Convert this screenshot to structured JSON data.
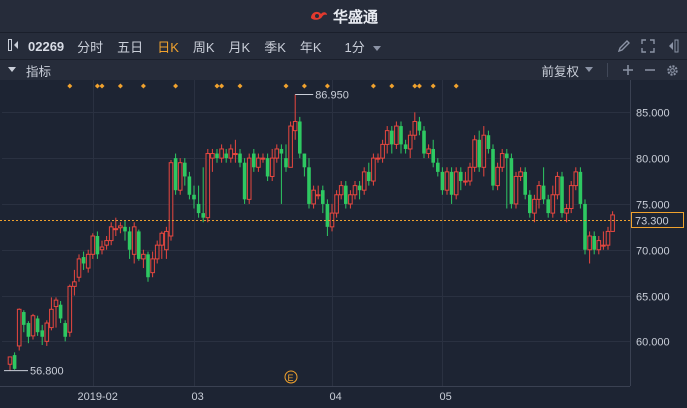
{
  "app": {
    "name": "华盛通"
  },
  "toolbar": {
    "stock_code": "02269",
    "periods": [
      {
        "label": "分时",
        "active": false
      },
      {
        "label": "五日",
        "active": false
      },
      {
        "label": "日K",
        "active": true
      },
      {
        "label": "周K",
        "active": false
      },
      {
        "label": "月K",
        "active": false
      },
      {
        "label": "季K",
        "active": false
      },
      {
        "label": "年K",
        "active": false
      },
      {
        "label": "1分",
        "active": false
      }
    ]
  },
  "indicator_bar": {
    "label": "指标",
    "adjust": "前复权"
  },
  "colors": {
    "up": "#e8473f",
    "down": "#2ec862",
    "accent": "#f0a22e"
  },
  "chart_data": {
    "type": "candlestick",
    "ylim": [
      56,
      87
    ],
    "y_ticks": [
      "85.000",
      "80.000",
      "75.000",
      "70.000",
      "65.000",
      "60.000"
    ],
    "x_tick_labels": [
      "2019-02",
      "03",
      "04",
      "05"
    ],
    "current_price": "73.300",
    "max_label": "86.950",
    "min_label": "56.800",
    "event_marker": "E",
    "candles": [
      [
        57.5,
        58.3,
        56.8,
        58.3
      ],
      [
        58.5,
        57.0,
        56.9,
        58.8
      ],
      [
        59.5,
        63.5,
        59.0,
        63.6
      ],
      [
        63.2,
        61.8,
        61.0,
        63.4
      ],
      [
        62.0,
        60.5,
        59.8,
        62.2
      ],
      [
        60.6,
        62.8,
        60.2,
        63.0
      ],
      [
        62.5,
        61.0,
        60.6,
        62.8
      ],
      [
        61.2,
        60.5,
        59.6,
        61.8
      ],
      [
        60.0,
        62.0,
        59.5,
        62.3
      ],
      [
        61.5,
        63.5,
        61.2,
        64.8
      ],
      [
        63.8,
        64.5,
        61.5,
        64.8
      ],
      [
        64.0,
        62.5,
        62.0,
        64.4
      ],
      [
        62.0,
        60.5,
        60.0,
        62.3
      ],
      [
        61.0,
        66.0,
        60.5,
        66.2
      ],
      [
        66.0,
        66.5,
        65.0,
        67.8
      ],
      [
        67.0,
        69.0,
        66.5,
        69.5
      ],
      [
        69.2,
        68.5,
        67.8,
        69.8
      ],
      [
        68.0,
        69.5,
        67.5,
        70.0
      ],
      [
        69.5,
        71.5,
        69.0,
        71.8
      ],
      [
        71.5,
        69.5,
        69.0,
        72.0
      ],
      [
        70.0,
        70.3,
        69.5,
        71.0
      ],
      [
        70.5,
        71.0,
        70.0,
        71.5
      ],
      [
        71.0,
        72.5,
        70.5,
        73.0
      ],
      [
        72.3,
        72.3,
        71.5,
        73.5
      ],
      [
        72.4,
        72.6,
        71.8,
        73.0
      ],
      [
        72.5,
        72.0,
        71.0,
        73.2
      ],
      [
        72.0,
        70.0,
        69.0,
        72.5
      ],
      [
        69.5,
        72.5,
        68.5,
        73.0
      ],
      [
        72.0,
        69.0,
        68.8,
        72.2
      ],
      [
        69.0,
        69.5,
        68.0,
        70.0
      ],
      [
        69.5,
        67.0,
        66.5,
        69.8
      ],
      [
        67.5,
        69.0,
        67.0,
        69.8
      ],
      [
        69.0,
        70.5,
        68.5,
        71.0
      ],
      [
        70.5,
        71.8,
        69.0,
        72.0
      ],
      [
        70.0,
        72.0,
        69.0,
        72.5
      ],
      [
        71.5,
        79.5,
        71.0,
        79.8
      ],
      [
        80.0,
        76.5,
        76.0,
        80.5
      ],
      [
        76.5,
        79.5,
        76.0,
        80.0
      ],
      [
        79.5,
        78.0,
        77.0,
        80.0
      ],
      [
        78.0,
        76.0,
        75.5,
        78.5
      ],
      [
        76.0,
        75.5,
        74.5,
        77.0
      ],
      [
        75.0,
        74.0,
        73.5,
        77.0
      ],
      [
        74.0,
        73.5,
        73.0,
        79.0
      ],
      [
        73.5,
        80.5,
        73.0,
        81.0
      ],
      [
        80.0,
        80.5,
        78.5,
        81.0
      ],
      [
        80.5,
        80.0,
        79.5,
        81.0
      ],
      [
        80.0,
        81.0,
        79.5,
        81.5
      ],
      [
        80.5,
        80.0,
        79.5,
        81.0
      ],
      [
        80.0,
        81.0,
        79.5,
        81.5
      ],
      [
        80.5,
        80.5,
        79.5,
        82.0
      ],
      [
        80.5,
        79.5,
        79.0,
        81.0
      ],
      [
        79.5,
        75.5,
        75.0,
        80.0
      ],
      [
        75.5,
        80.0,
        75.0,
        80.5
      ],
      [
        80.5,
        79.0,
        78.5,
        81.0
      ],
      [
        79.0,
        80.0,
        78.5,
        80.5
      ],
      [
        80.0,
        80.0,
        79.5,
        80.5
      ],
      [
        80.0,
        78.0,
        77.5,
        80.5
      ],
      [
        78.0,
        80.0,
        77.5,
        81.0
      ],
      [
        80.0,
        81.0,
        79.5,
        81.5
      ],
      [
        81.0,
        80.5,
        75.0,
        81.5
      ],
      [
        80.0,
        79.0,
        78.5,
        81.5
      ],
      [
        79.0,
        83.5,
        79.0,
        84.0
      ],
      [
        83.0,
        84.0,
        82.0,
        86.95
      ],
      [
        84.0,
        80.5,
        80.0,
        84.5
      ],
      [
        80.5,
        79.0,
        78.0,
        80.5
      ],
      [
        79.0,
        75.0,
        74.5,
        80.0
      ],
      [
        75.0,
        76.5,
        74.5,
        77.0
      ],
      [
        76.0,
        76.0,
        75.5,
        77.0
      ],
      [
        76.5,
        75.0,
        74.0,
        77.0
      ],
      [
        75.0,
        72.5,
        71.5,
        75.5
      ],
      [
        72.5,
        74.0,
        72.0,
        75.0
      ],
      [
        74.0,
        76.0,
        73.5,
        76.5
      ],
      [
        76.0,
        77.0,
        75.5,
        77.5
      ],
      [
        77.0,
        75.0,
        74.5,
        77.5
      ],
      [
        75.0,
        76.0,
        74.5,
        76.5
      ],
      [
        76.0,
        77.0,
        75.5,
        77.5
      ],
      [
        77.0,
        76.5,
        75.5,
        77.5
      ],
      [
        76.5,
        78.5,
        76.0,
        79.0
      ],
      [
        78.5,
        77.5,
        77.0,
        79.5
      ],
      [
        77.5,
        80.0,
        77.0,
        80.5
      ],
      [
        80.0,
        80.0,
        79.5,
        80.5
      ],
      [
        80.0,
        81.5,
        79.5,
        82.0
      ],
      [
        81.5,
        83.0,
        80.5,
        83.5
      ],
      [
        83.0,
        81.5,
        80.5,
        83.5
      ],
      [
        81.5,
        83.5,
        81.0,
        84.0
      ],
      [
        83.5,
        81.5,
        80.5,
        84.0
      ],
      [
        81.5,
        81.0,
        80.5,
        82.0
      ],
      [
        81.0,
        82.5,
        80.0,
        83.0
      ],
      [
        82.5,
        84.0,
        82.0,
        85.0
      ],
      [
        84.0,
        83.0,
        82.5,
        84.5
      ],
      [
        83.0,
        80.5,
        80.0,
        83.5
      ],
      [
        80.5,
        81.0,
        80.0,
        81.5
      ],
      [
        81.0,
        79.5,
        79.0,
        82.0
      ],
      [
        79.5,
        78.5,
        78.0,
        80.0
      ],
      [
        78.5,
        76.5,
        76.0,
        79.0
      ],
      [
        76.5,
        78.5,
        76.0,
        79.0
      ],
      [
        78.5,
        76.0,
        75.0,
        79.0
      ],
      [
        76.0,
        78.5,
        75.5,
        79.0
      ],
      [
        78.5,
        77.5,
        76.5,
        79.0
      ],
      [
        77.5,
        77.5,
        77.0,
        78.5
      ],
      [
        77.5,
        79.0,
        77.0,
        79.5
      ],
      [
        79.0,
        82.0,
        78.5,
        82.5
      ],
      [
        82.0,
        79.0,
        78.5,
        83.0
      ],
      [
        79.0,
        82.5,
        78.0,
        83.5
      ],
      [
        82.5,
        81.0,
        80.5,
        83.0
      ],
      [
        81.0,
        77.0,
        76.5,
        81.5
      ],
      [
        77.0,
        79.0,
        76.5,
        79.5
      ],
      [
        79.0,
        80.5,
        78.5,
        81.0
      ],
      [
        80.5,
        80.0,
        74.5,
        81.0
      ],
      [
        80.0,
        75.0,
        74.5,
        80.5
      ],
      [
        75.0,
        78.0,
        74.5,
        78.5
      ],
      [
        78.0,
        78.5,
        77.5,
        79.0
      ],
      [
        78.5,
        76.0,
        75.5,
        79.0
      ],
      [
        76.0,
        74.0,
        73.5,
        76.5
      ],
      [
        74.0,
        75.5,
        73.0,
        76.0
      ],
      [
        75.5,
        77.0,
        74.5,
        77.5
      ],
      [
        77.0,
        75.5,
        75.0,
        79.0
      ],
      [
        75.5,
        74.0,
        73.5,
        76.0
      ],
      [
        74.0,
        76.0,
        73.5,
        77.0
      ],
      [
        76.0,
        78.0,
        75.5,
        78.5
      ],
      [
        78.0,
        74.0,
        73.5,
        78.5
      ],
      [
        74.0,
        74.5,
        73.0,
        75.0
      ],
      [
        74.5,
        77.0,
        74.0,
        77.5
      ],
      [
        77.0,
        78.5,
        76.5,
        79.0
      ],
      [
        78.5,
        75.0,
        74.5,
        79.0
      ],
      [
        75.0,
        70.0,
        69.5,
        75.5
      ],
      [
        70.0,
        71.5,
        68.5,
        72.0
      ],
      [
        71.5,
        70.0,
        69.5,
        72.0
      ],
      [
        70.0,
        71.0,
        69.5,
        71.5
      ],
      [
        70.5,
        70.5,
        70.0,
        72.0
      ],
      [
        70.5,
        72.0,
        70.0,
        72.5
      ],
      [
        72.0,
        73.8,
        72.0,
        74.2
      ]
    ],
    "markers_at": [
      13,
      19,
      20,
      24,
      29,
      36,
      45,
      46,
      50,
      60,
      64,
      69,
      79,
      83,
      88,
      89,
      92,
      97
    ]
  }
}
